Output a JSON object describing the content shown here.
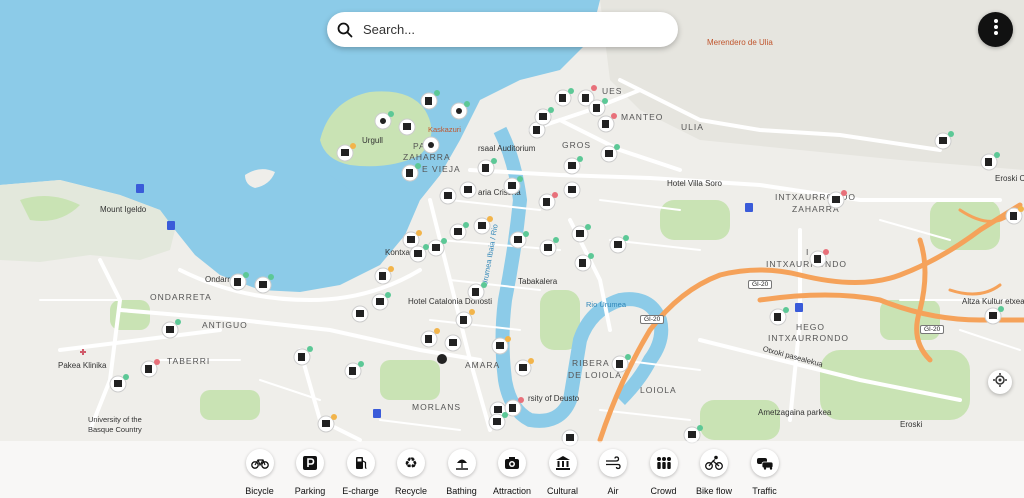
{
  "search": {
    "placeholder": "Search..."
  },
  "map_labels": {
    "mount_igeldo": "Mount Igeldo",
    "ondarreta": "ONDARRETA",
    "antiguo": "ANTIGUO",
    "pakea_klinika": "Pakea Klinika",
    "taberri": "TABERRI",
    "univ1": "University of the",
    "univ2": "Basque Country",
    "morlans": "MORLANS",
    "amara": "AMARA",
    "ondarreta_beach": "Ondarr",
    "hotel_catalonia": "Hotel Catalonia Donosti",
    "kontxa": "Kontxa",
    "urgull": "Urgull",
    "kaskazuri": "Kaskazuri",
    "parte_zaharra": "PA",
    "zaharra": "ZAHARRA",
    "vieja": "E VIEJA",
    "kursaal": "rsaal Auditorium",
    "gros": "GROS",
    "ues": "UES",
    "manteo": "MANTEO",
    "ulia": "ULIA",
    "merendero": "Merendero de Ulia",
    "hotel_villa_soro": "Hotel Villa Soro",
    "intxaurrondo_zaharra1": "INTXAURRONDO",
    "intxaurrondo_zaharra2": "ZAHARRA",
    "intxaurrondo": "INTXAURRONDO",
    "hego_intxaurrondo1": "HEGO",
    "hego_intxaurrondo2": "INTXAURRONDO",
    "otxoki": "Otxoki pasealekua",
    "ametzagaina": "Ametzagaina parkea",
    "altza": "Altza Kultur etxea",
    "eroski1": "Eroski C",
    "eroski2": "Eroski",
    "tabakalera": "Tabakalera",
    "rio_urumea": "Rio Urumea",
    "urumea_ibaia": "Urumea Ibaia / Rio",
    "ribera1": "RIBERA",
    "ribera2": "DE LOIOLA",
    "loiola": "LOIOLA",
    "deusto": "rsity of Deusto",
    "maria_cristina": "aria Cristina",
    "gi20_a": "GI-20",
    "gi20_b": "GI-20",
    "gi20_c": "GI-20",
    "i_partial": "I"
  },
  "categories": [
    {
      "label": "Bicycle",
      "icon": "bicycle-icon"
    },
    {
      "label": "Parking",
      "icon": "parking-icon"
    },
    {
      "label": "E-charge",
      "icon": "fuel-pump-icon"
    },
    {
      "label": "Recycle",
      "icon": "recycle-icon"
    },
    {
      "label": "Bathing",
      "icon": "beach-umbrella-icon"
    },
    {
      "label": "Attraction",
      "icon": "camera-icon"
    },
    {
      "label": "Cultural",
      "icon": "museum-icon"
    },
    {
      "label": "Air",
      "icon": "wind-icon"
    },
    {
      "label": "Crowd",
      "icon": "people-icon"
    },
    {
      "label": "Bike flow",
      "icon": "cyclist-icon"
    },
    {
      "label": "Traffic",
      "icon": "cars-icon"
    }
  ],
  "colors": {
    "water": "#8ccbe8",
    "land": "#efeeea",
    "park": "#c9e3b4",
    "road": "#ffffff",
    "highway": "#f5a25a",
    "status_ok": "#5cc896",
    "status_warn": "#f2b44a",
    "status_bad": "#e8707a"
  }
}
